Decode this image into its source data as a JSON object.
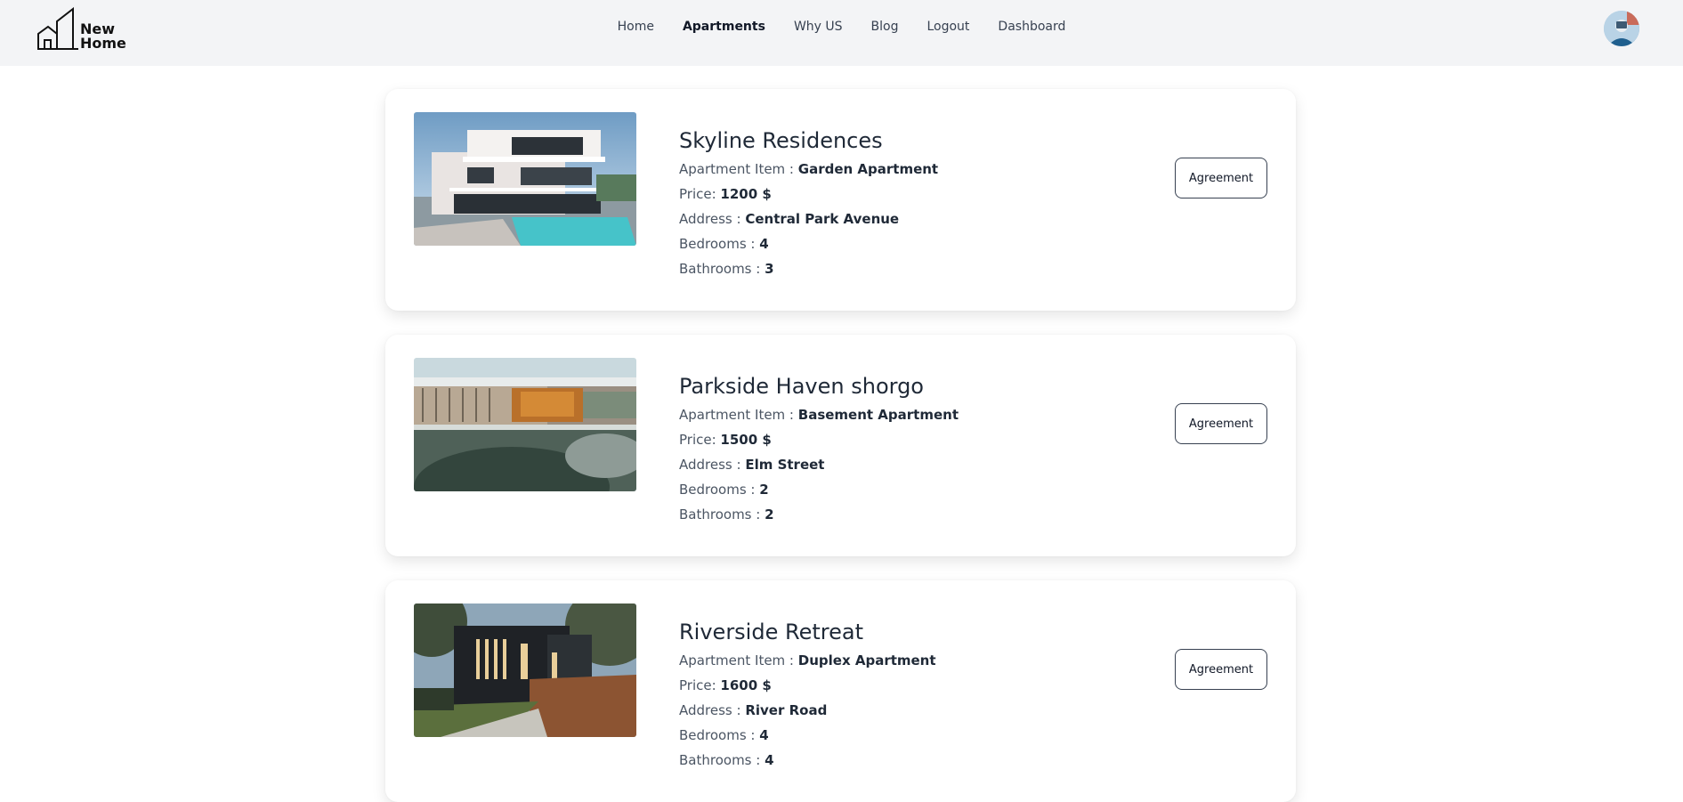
{
  "brand": {
    "line1": "New",
    "line2": "Home"
  },
  "nav": {
    "items": [
      {
        "label": "Home",
        "active": false
      },
      {
        "label": "Apartments",
        "active": true
      },
      {
        "label": "Why US",
        "active": false
      },
      {
        "label": "Blog",
        "active": false
      },
      {
        "label": "Logout",
        "active": false
      },
      {
        "label": "Dashboard",
        "active": false
      }
    ]
  },
  "labels": {
    "item": "Apartment Item : ",
    "price": "Price: ",
    "address": "Address : ",
    "bedrooms": "Bedrooms : ",
    "bathrooms": "Bathrooms : ",
    "agreement": "Agreement"
  },
  "apartments": [
    {
      "title": "Skyline Residences",
      "item": "Garden Apartment",
      "price": "1200 $",
      "address": "Central Park Avenue",
      "bedrooms": "4",
      "bathrooms": "3"
    },
    {
      "title": "Parkside Haven shorgo",
      "item": "Basement Apartment",
      "price": "1500 $",
      "address": "Elm Street",
      "bedrooms": "2",
      "bathrooms": "2"
    },
    {
      "title": "Riverside Retreat",
      "item": "Duplex Apartment",
      "price": "1600 $",
      "address": "River Road",
      "bedrooms": "4",
      "bathrooms": "4"
    }
  ]
}
